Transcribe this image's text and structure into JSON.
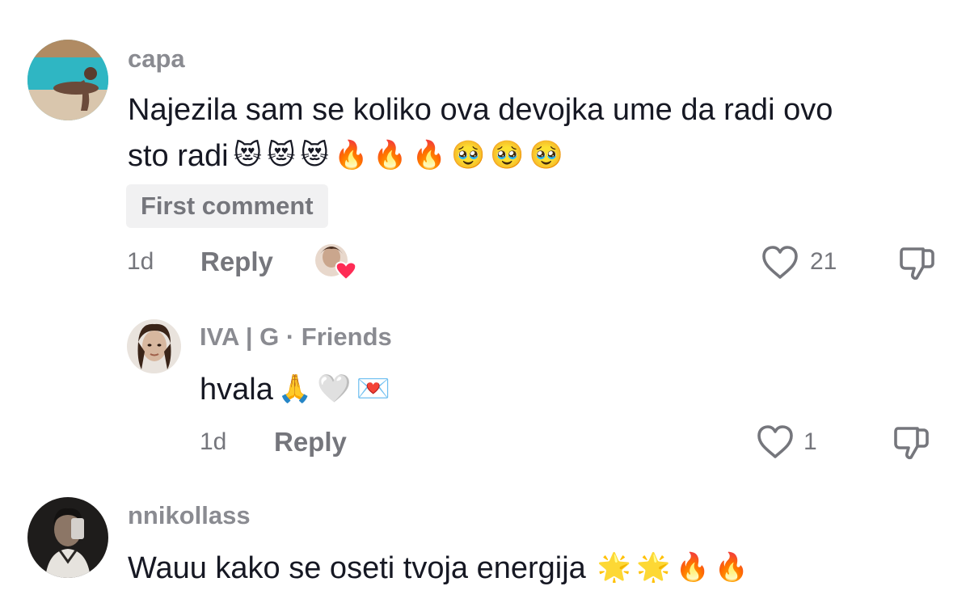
{
  "comments": [
    {
      "username": "capa",
      "text": "Najezila sam se koliko ova devojka ume da radi ovo",
      "text_line2": "sto radi",
      "emojis_line2": [
        "😻",
        "😻",
        "😻",
        "🔥",
        "🔥",
        "🔥",
        "🥹",
        "🥹",
        "🥹"
      ],
      "badge": "First comment",
      "time": "1d",
      "reply_label": "Reply",
      "likes": "21",
      "creator_liked": true
    },
    {
      "username": "IVA | G · Friends",
      "text": "hvala",
      "emojis": [
        "🙏",
        "🤍",
        "💌"
      ],
      "time": "1d",
      "reply_label": "Reply",
      "likes": "1"
    },
    {
      "username": "nnikollass",
      "text": "Wauu kako se oseti tvoja energija",
      "emojis": [
        "🌟",
        "🌟",
        "🔥",
        "🔥"
      ]
    }
  ],
  "colors": {
    "text_primary": "#161823",
    "text_secondary": "#8a8b91",
    "badge_bg": "#f1f1f2",
    "heart_badge": "#fe2c55"
  },
  "icons": {
    "like": "heart-outline-icon",
    "dislike": "thumbs-down-icon",
    "creator_like": "creator-heart-avatar-icon"
  }
}
